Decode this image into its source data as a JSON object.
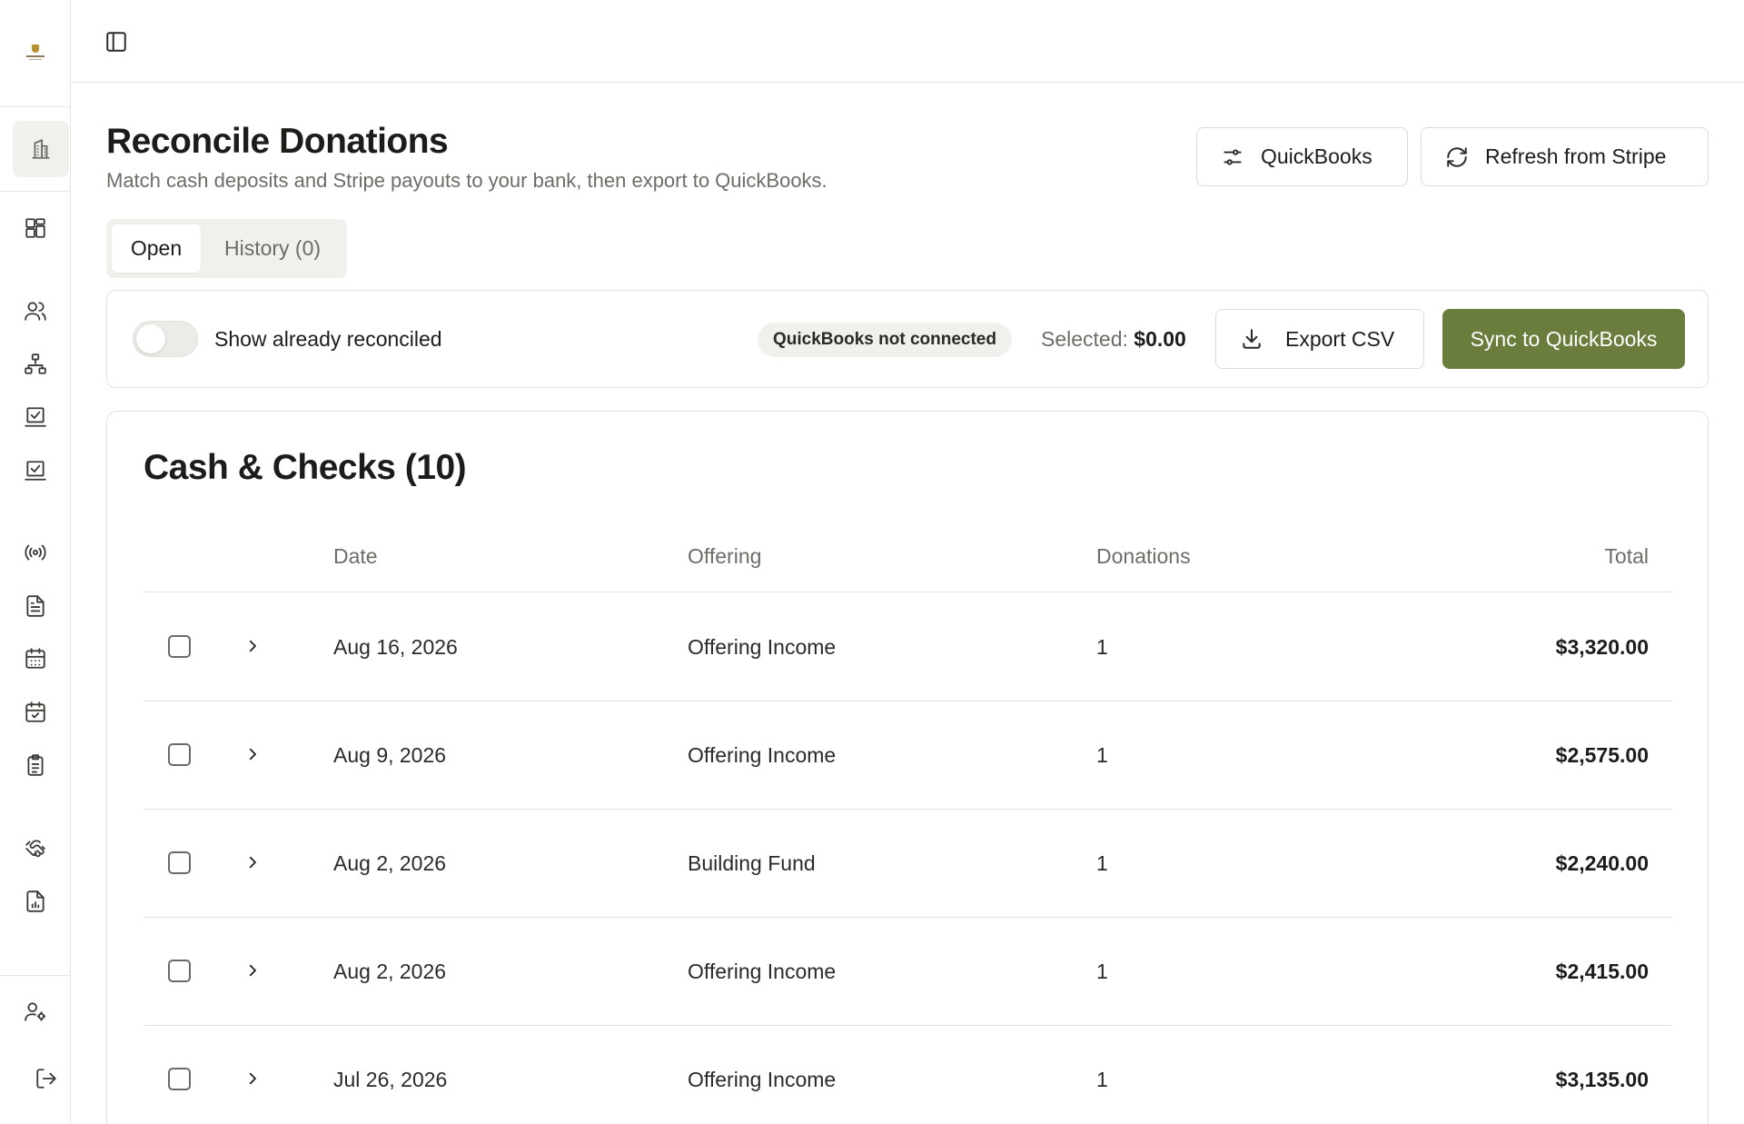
{
  "header": {
    "title": "Reconcile Donations",
    "subtitle": "Match cash deposits and Stripe payouts to your bank, then export to QuickBooks.",
    "quickbooks_button": "QuickBooks",
    "refresh_button": "Refresh from Stripe"
  },
  "tabs": [
    {
      "label": "Open",
      "active": true
    },
    {
      "label": "History (0)",
      "active": false
    }
  ],
  "toolbar": {
    "toggle_label": "Show already reconciled",
    "toggle_on": false,
    "status_badge": "QuickBooks not connected",
    "selected_label": "Selected:",
    "selected_value": "$0.00",
    "export_button": "Export CSV",
    "sync_button": "Sync to QuickBooks"
  },
  "table": {
    "title": "Cash & Checks (10)",
    "columns": [
      "Date",
      "Offering",
      "Donations",
      "Total"
    ],
    "rows": [
      {
        "date": "Aug 16, 2026",
        "offering": "Offering Income",
        "donations": "1",
        "total": "$3,320.00"
      },
      {
        "date": "Aug 9, 2026",
        "offering": "Offering Income",
        "donations": "1",
        "total": "$2,575.00"
      },
      {
        "date": "Aug 2, 2026",
        "offering": "Building Fund",
        "donations": "1",
        "total": "$2,240.00"
      },
      {
        "date": "Aug 2, 2026",
        "offering": "Offering Income",
        "donations": "1",
        "total": "$2,415.00"
      },
      {
        "date": "Jul 26, 2026",
        "offering": "Offering Income",
        "donations": "1",
        "total": "$3,135.00"
      }
    ]
  },
  "sidebar": {
    "icons": [
      "building-icon",
      "dashboard-icon",
      "users-icon",
      "org-chart-icon",
      "checklist-icon",
      "checklist-icon",
      "broadcast-icon",
      "document-icon",
      "calendar-icon",
      "calendar-check-icon",
      "clipboard-icon",
      "handshake-icon",
      "report-icon",
      "user-settings-icon",
      "logout-icon"
    ]
  },
  "colors": {
    "accent": "#6a7d3c",
    "border": "#e2e1dc",
    "muted_text": "#6d6d68"
  }
}
